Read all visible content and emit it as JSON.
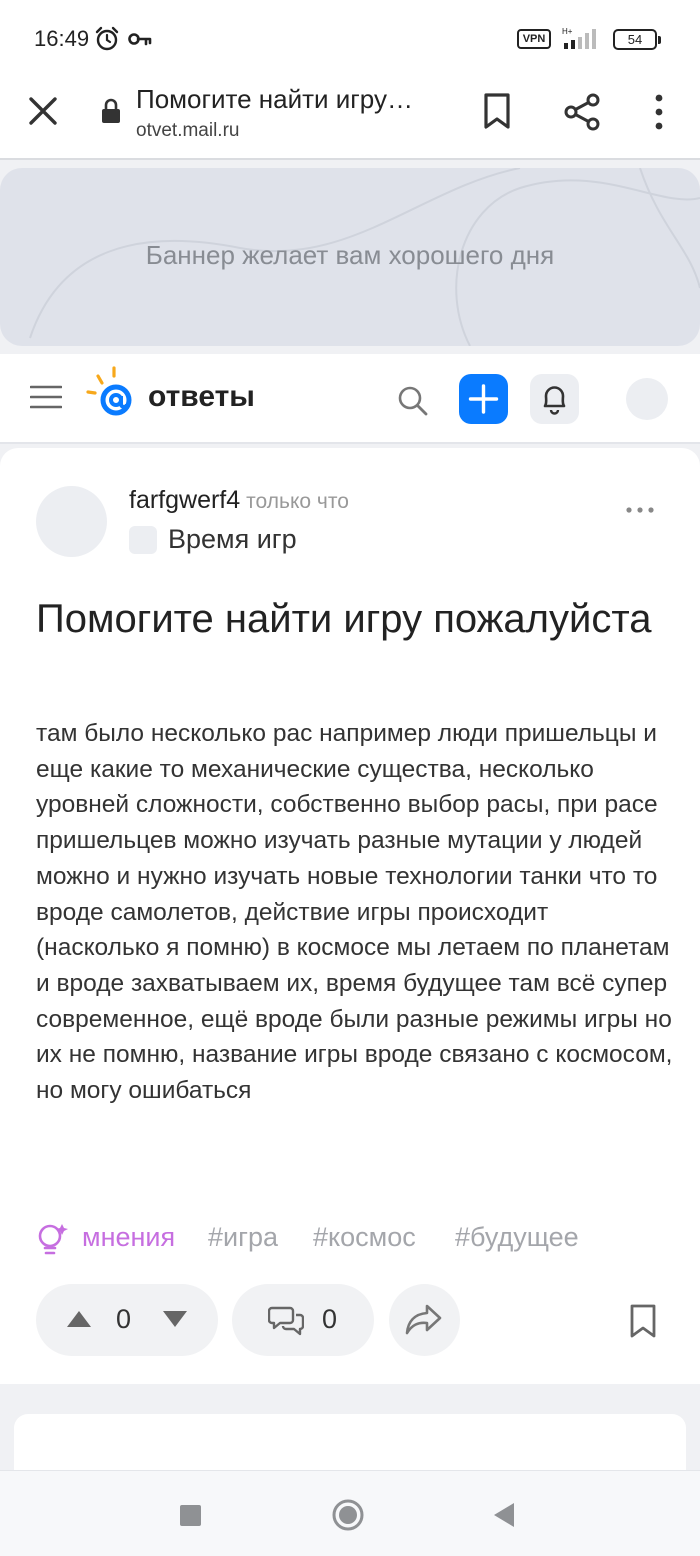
{
  "status_bar": {
    "time": "16:49",
    "vpn": "VPN",
    "network": "H+",
    "battery": "54",
    "icons": [
      "alarm-icon",
      "key-icon",
      "signal-icon",
      "battery-icon"
    ]
  },
  "browser": {
    "title": "Помогите найти игру…",
    "url": "otvet.mail.ru",
    "icons": [
      "close-icon",
      "lock-icon",
      "bookmark-icon",
      "share-icon",
      "more-vert-icon"
    ]
  },
  "banner": {
    "text": "Баннер желает вам хорошего дня"
  },
  "site_header": {
    "logo_text": "ответы",
    "accent_color": "#0a7bff",
    "logo_sun_color": "#f7a81b",
    "icons": [
      "menu-icon",
      "search-icon",
      "plus-icon",
      "bell-icon"
    ]
  },
  "question": {
    "author": "farfgwerf4",
    "time": "только что",
    "category": "Время игр",
    "title": "Помогите найти игру пожалуйста",
    "body": "там было несколько рас например люди пришельцы и еще какие то механические существа, несколько уровней сложности, собственно выбор расы, при расе пришельцев можно изучать разные мутации у людей можно и нужно изучать новые технологии танки что то вроде самолетов, действие игры происходит (насколько я помню) в космосе мы летаем по планетам и вроде захватываем их, время будущее там всё супер современное, ещё вроде были разные режимы игры но их не помню, название игры вроде связано с космосом, но могу ошибаться",
    "tags": {
      "opinions": "мнения",
      "items": [
        "#игра",
        "#космос",
        "#будущее"
      ]
    },
    "votes": "0",
    "comments": "0",
    "opinions_color": "#c66ee0"
  },
  "nav": {
    "icons": [
      "recent-apps-icon",
      "home-icon",
      "back-icon"
    ]
  }
}
